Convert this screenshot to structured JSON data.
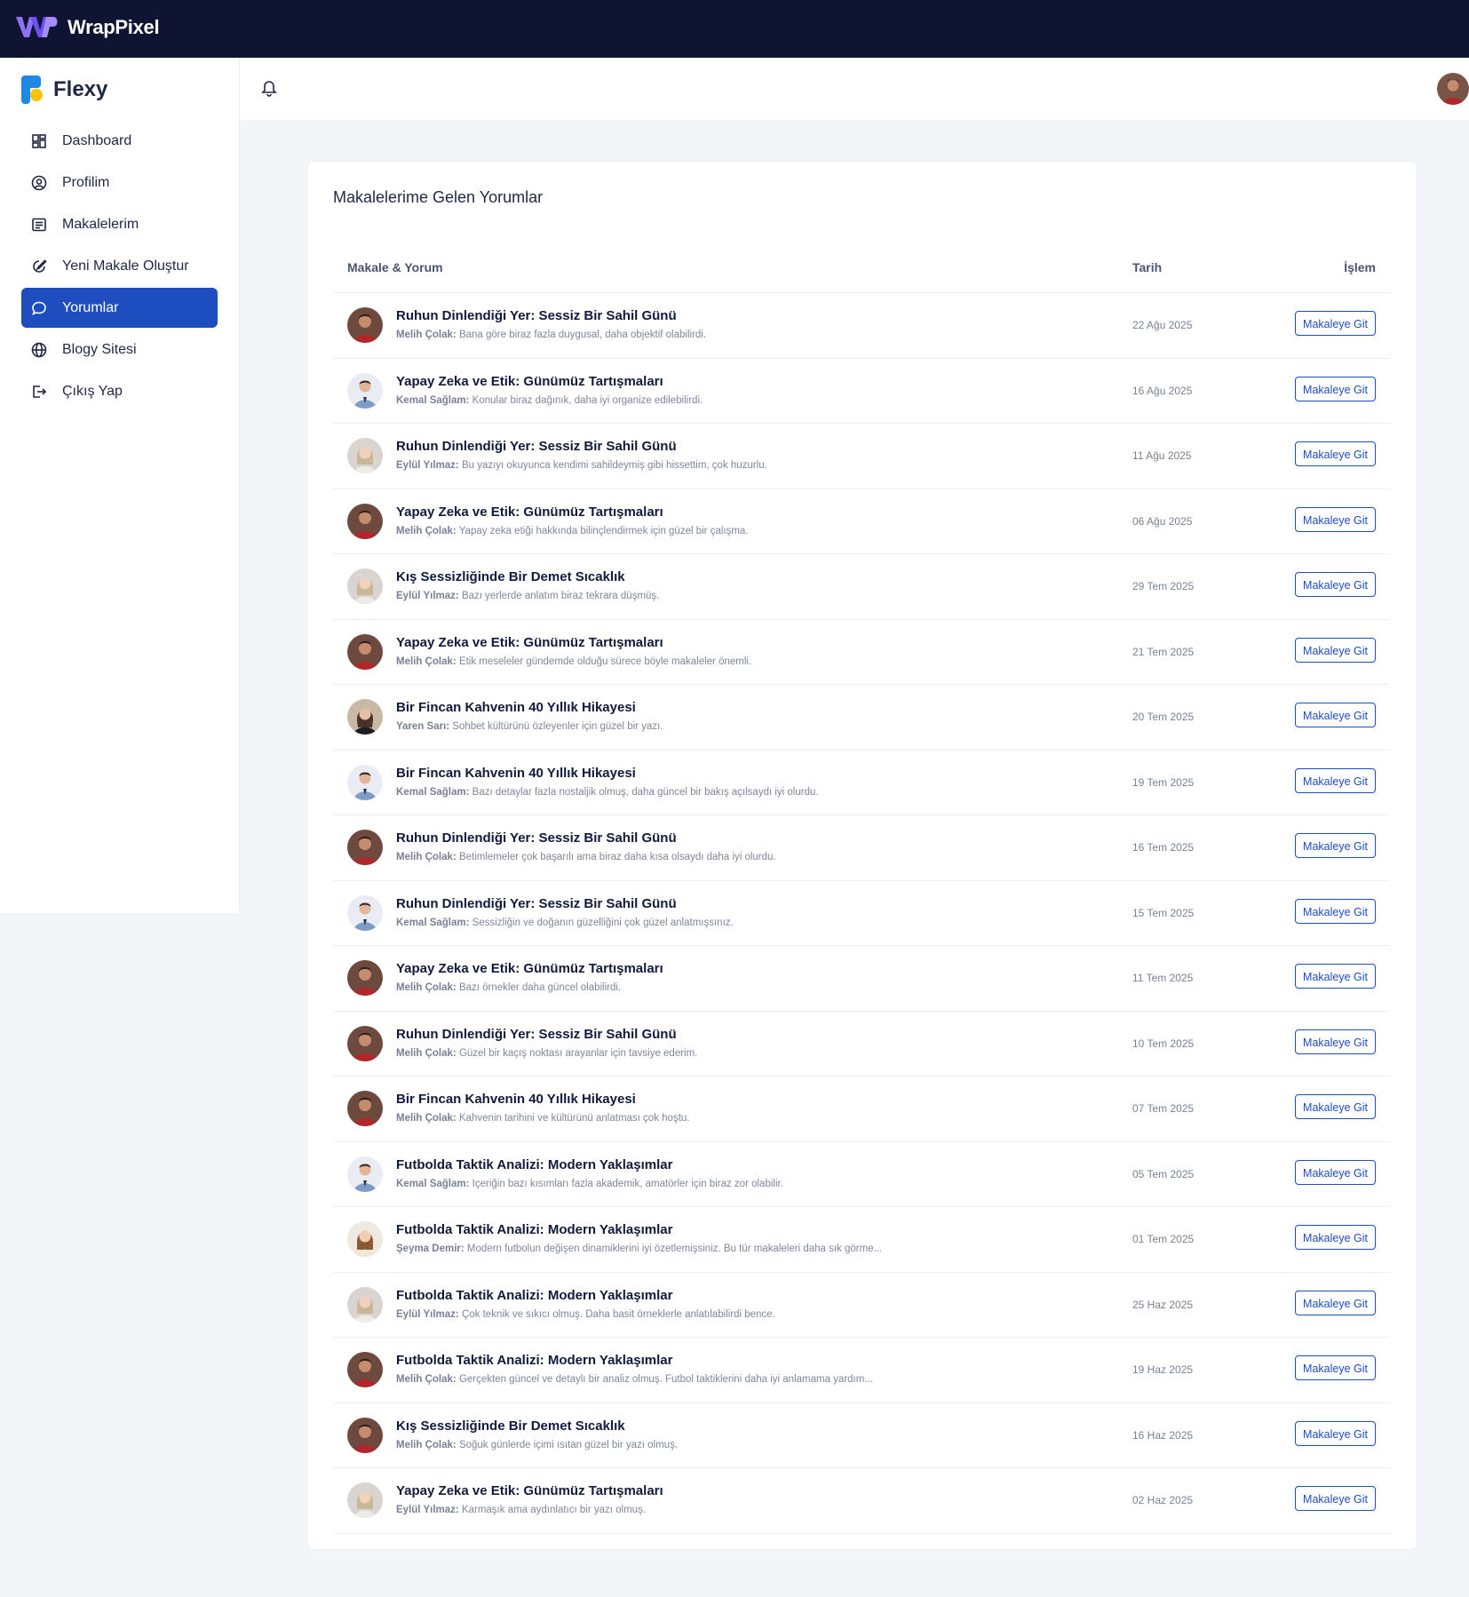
{
  "topbar": {
    "brand": "WrapPixel"
  },
  "sidebar": {
    "brand": "Flexy",
    "items": [
      {
        "label": "Dashboard",
        "icon": "dashboard-icon",
        "active": false
      },
      {
        "label": "Profilim",
        "icon": "user-circle-icon",
        "active": false
      },
      {
        "label": "Makalelerim",
        "icon": "article-list-icon",
        "active": false
      },
      {
        "label": "Yeni Makale Oluştur",
        "icon": "edit-pencil-icon",
        "active": false
      },
      {
        "label": "Yorumlar",
        "icon": "message-icon",
        "active": true
      },
      {
        "label": "Blogy Sitesi",
        "icon": "globe-icon",
        "active": false
      },
      {
        "label": "Çıkış Yap",
        "icon": "logout-icon",
        "active": false
      }
    ]
  },
  "main": {
    "title": "Makalelerime Gelen Yorumlar",
    "columns": {
      "article": "Makale & Yorum",
      "date": "Tarih",
      "action": "İşlem"
    },
    "button_label": "Makaleye Git",
    "rows": [
      {
        "title": "Ruhun Dinlendiği Yer: Sessiz Bir Sahil Günü",
        "author": "Melih Çolak:",
        "comment": "Bana göre biraz fazla duygusal, daha objektif olabilirdi.",
        "date": "22 Ağu 2025",
        "avatar": "melih"
      },
      {
        "title": "Yapay Zeka ve Etik: Günümüz Tartışmaları",
        "author": "Kemal Sağlam:",
        "comment": "Konular biraz dağınık, daha iyi organize edilebilirdi.",
        "date": "16 Ağu 2025",
        "avatar": "kemal"
      },
      {
        "title": "Ruhun Dinlendiği Yer: Sessiz Bir Sahil Günü",
        "author": "Eylül Yılmaz:",
        "comment": "Bu yazıyı okuyunca kendimi sahildeymiş gibi hissettim, çok huzurlu.",
        "date": "11 Ağu 2025",
        "avatar": "eylul"
      },
      {
        "title": "Yapay Zeka ve Etik: Günümüz Tartışmaları",
        "author": "Melih Çolak:",
        "comment": "Yapay zeka etiği hakkında bilinçlendirmek için güzel bir çalışma.",
        "date": "06 Ağu 2025",
        "avatar": "melih"
      },
      {
        "title": "Kış Sessizliğinde Bir Demet Sıcaklık",
        "author": "Eylül Yılmaz:",
        "comment": "Bazı yerlerde anlatım biraz tekrara düşmüş.",
        "date": "29 Tem 2025",
        "avatar": "eylul"
      },
      {
        "title": "Yapay Zeka ve Etik: Günümüz Tartışmaları",
        "author": "Melih Çolak:",
        "comment": "Etik meseleler gündemde olduğu sürece böyle makaleler önemli.",
        "date": "21 Tem 2025",
        "avatar": "melih"
      },
      {
        "title": "Bir Fincan Kahvenin 40 Yıllık Hikayesi",
        "author": "Yaren Sarı:",
        "comment": "Sohbet kültürünü özleyenler için güzel bir yazı.",
        "date": "20 Tem 2025",
        "avatar": "yaren"
      },
      {
        "title": "Bir Fincan Kahvenin 40 Yıllık Hikayesi",
        "author": "Kemal Sağlam:",
        "comment": "Bazı detaylar fazla nostaljik olmuş, daha güncel bir bakış açılsaydı iyi olurdu.",
        "date": "19 Tem 2025",
        "avatar": "kemal"
      },
      {
        "title": "Ruhun Dinlendiği Yer: Sessiz Bir Sahil Günü",
        "author": "Melih Çolak:",
        "comment": "Betimlemeler çok başarılı ama biraz daha kısa olsaydı daha iyi olurdu.",
        "date": "16 Tem 2025",
        "avatar": "melih"
      },
      {
        "title": "Ruhun Dinlendiği Yer: Sessiz Bir Sahil Günü",
        "author": "Kemal Sağlam:",
        "comment": "Sessizliğin ve doğanın güzelliğini çok güzel anlatmışsınız.",
        "date": "15 Tem 2025",
        "avatar": "kemal"
      },
      {
        "title": "Yapay Zeka ve Etik: Günümüz Tartışmaları",
        "author": "Melih Çolak:",
        "comment": "Bazı örnekler daha güncel olabilirdi.",
        "date": "11 Tem 2025",
        "avatar": "melih"
      },
      {
        "title": "Ruhun Dinlendiği Yer: Sessiz Bir Sahil Günü",
        "author": "Melih Çolak:",
        "comment": "Güzel bir kaçış noktası arayanlar için tavsiye ederim.",
        "date": "10 Tem 2025",
        "avatar": "melih"
      },
      {
        "title": "Bir Fincan Kahvenin 40 Yıllık Hikayesi",
        "author": "Melih Çolak:",
        "comment": "Kahvenin tarihini ve kültürünü anlatması çok hoştu.",
        "date": "07 Tem 2025",
        "avatar": "melih"
      },
      {
        "title": "Futbolda Taktik Analizi: Modern Yaklaşımlar",
        "author": "Kemal Sağlam:",
        "comment": "İçeriğin bazı kısımları fazla akademik, amatörler için biraz zor olabilir.",
        "date": "05 Tem 2025",
        "avatar": "kemal"
      },
      {
        "title": "Futbolda Taktik Analizi: Modern Yaklaşımlar",
        "author": "Şeyma Demir:",
        "comment": "Modern futbolun değişen dinamiklerini iyi özetlemişsiniz. Bu tür makaleleri daha sık görme...",
        "date": "01 Tem 2025",
        "avatar": "seyma"
      },
      {
        "title": "Futbolda Taktik Analizi: Modern Yaklaşımlar",
        "author": "Eylül Yılmaz:",
        "comment": "Çok teknik ve sıkıcı olmuş. Daha basit örneklerle anlatılabilirdi bence.",
        "date": "25 Haz 2025",
        "avatar": "eylul"
      },
      {
        "title": "Futbolda Taktik Analizi: Modern Yaklaşımlar",
        "author": "Melih Çolak:",
        "comment": "Gerçekten güncel ve detaylı bir analiz olmuş. Futbol taktiklerini daha iyi anlamama yardım...",
        "date": "19 Haz 2025",
        "avatar": "melih"
      },
      {
        "title": "Kış Sessizliğinde Bir Demet Sıcaklık",
        "author": "Melih Çolak:",
        "comment": "Soğuk günlerde içimi ısıtan güzel bir yazı olmuş.",
        "date": "16 Haz 2025",
        "avatar": "melih"
      },
      {
        "title": "Yapay Zeka ve Etik: Günümüz Tartışmaları",
        "author": "Eylül Yılmaz:",
        "comment": "Karmaşık ama aydınlatıcı bir yazı olmuş.",
        "date": "02 Haz 2025",
        "avatar": "eylul"
      }
    ]
  },
  "colors": {
    "topbar": "#0f1433",
    "primary": "#1e4dbf",
    "text": "#1f2744",
    "muted": "#7a8094"
  }
}
